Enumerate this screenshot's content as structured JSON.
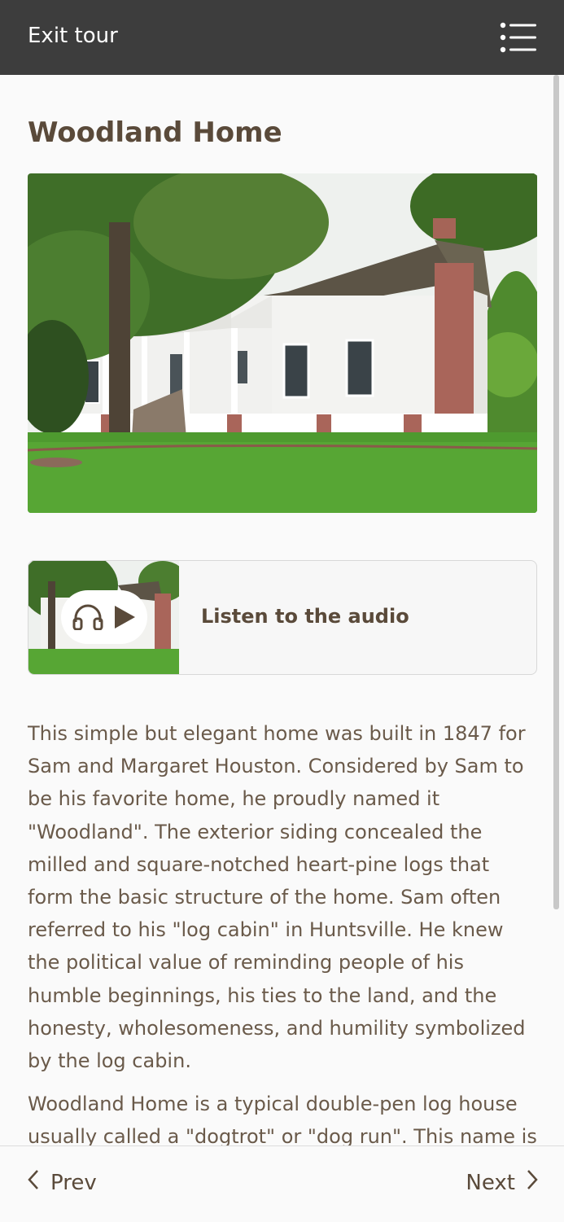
{
  "header": {
    "exit_label": "Exit tour",
    "menu_icon": "list-menu-icon"
  },
  "page": {
    "title": "Woodland Home"
  },
  "audio": {
    "label": "Listen to the audio",
    "icons": [
      "headphones-icon",
      "play-icon"
    ]
  },
  "body": {
    "paragraphs": [
      "This simple but elegant home was built in 1847 for Sam and Margaret Houston. Considered by Sam to be his favorite home, he proudly named it \"Woodland\". The exterior siding concealed the milled and square-notched heart-pine logs that form the basic structure of the home. Sam often referred to his \"log cabin\" in Huntsville. He knew the political value of reminding people of his humble beginnings, his ties to the land, and the honesty, wholesomeness, and humility symbolized by the log cabin.",
      "Woodland Home is a typical double-pen log house usually called a \"dogtrot\" or \"dog run\". This name is"
    ]
  },
  "footer": {
    "prev_label": "Prev",
    "next_label": "Next"
  },
  "colors": {
    "header_bg": "#3d3d3d",
    "title": "#5a4a3a",
    "body_text": "#6a5a4a",
    "page_bg": "#fafafa"
  }
}
